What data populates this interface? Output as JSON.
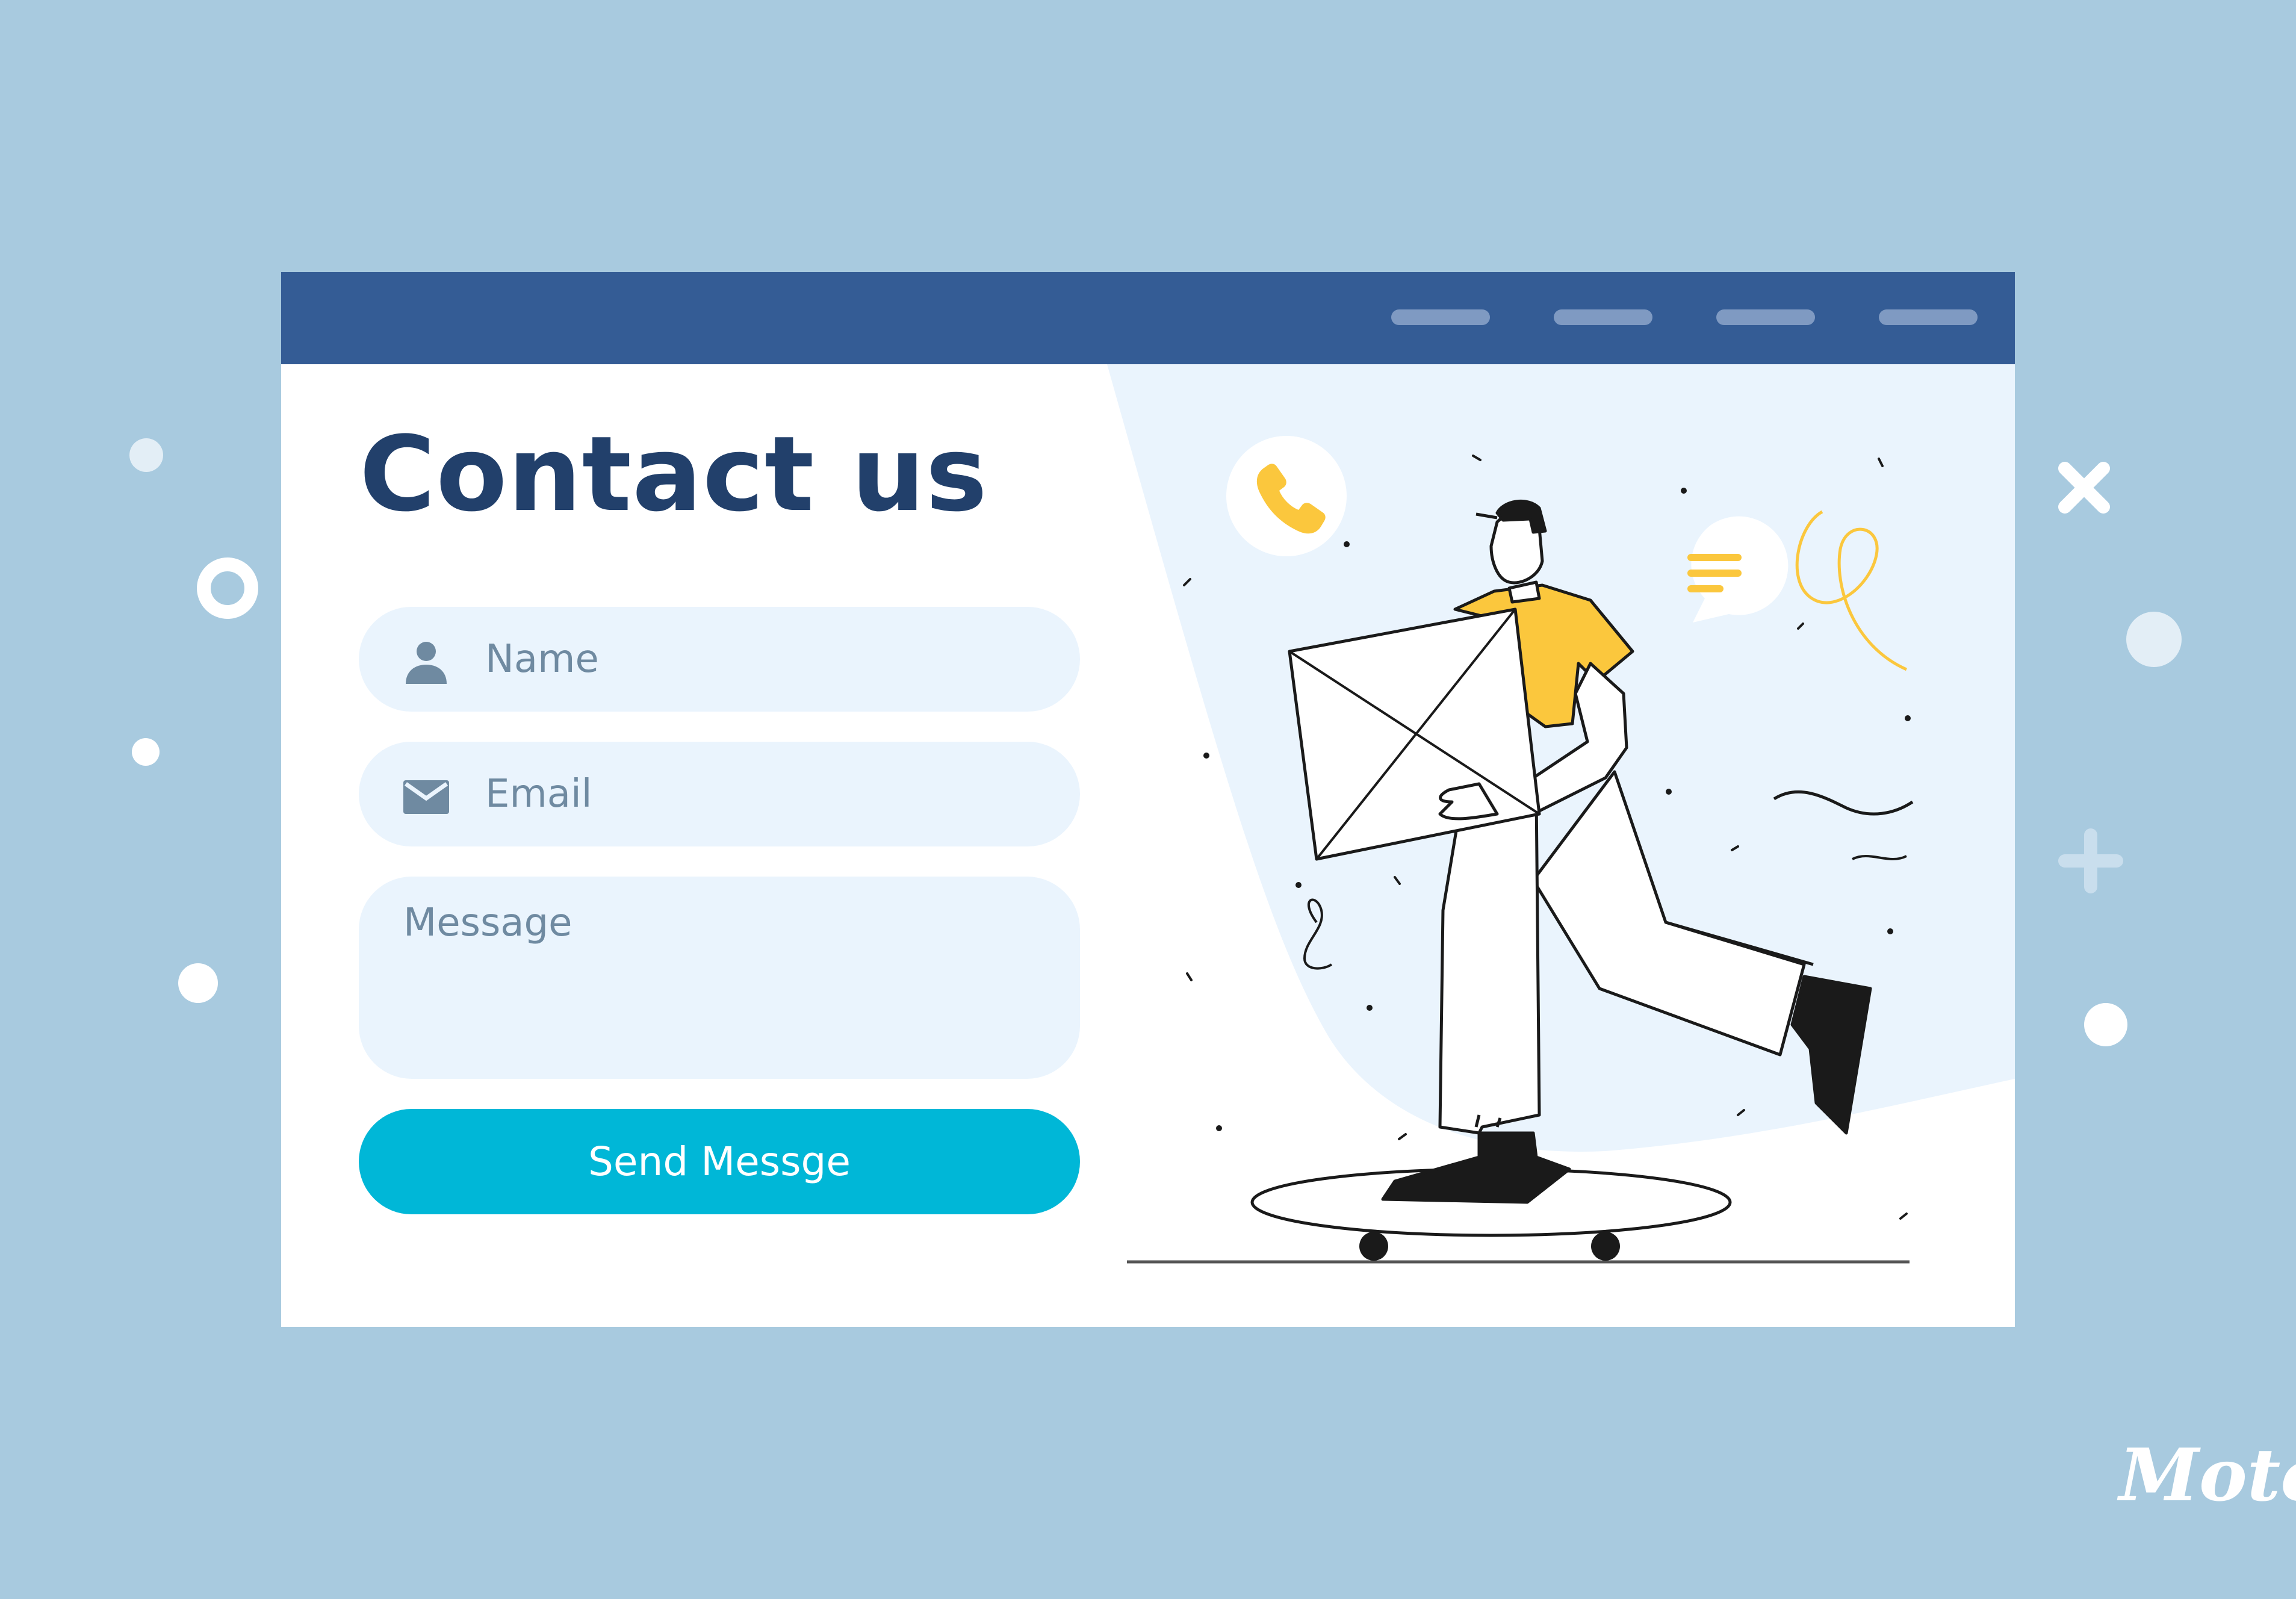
{
  "colors": {
    "background": "#a8cadf",
    "topbar": "#345c95",
    "nav_pill": "#7f9ac2",
    "title": "#22406b",
    "field_bg": "#eaf4fd",
    "placeholder": "#6f8aa1",
    "button": "#00b7d7",
    "accent_yellow": "#fbc73d"
  },
  "nav": {
    "items": [
      "",
      "",
      "",
      ""
    ]
  },
  "form": {
    "title": "Contact us",
    "name_placeholder": "Name",
    "name_icon": "user-icon",
    "email_placeholder": "Email",
    "email_icon": "envelope-icon",
    "message_placeholder": "Message",
    "submit_label": "Send Messge"
  },
  "illustration": {
    "badges": [
      "phone-icon",
      "chat-lines-icon"
    ],
    "subject": "person-on-skateboard-carrying-envelope"
  },
  "watermark": {
    "text": "Motol"
  }
}
